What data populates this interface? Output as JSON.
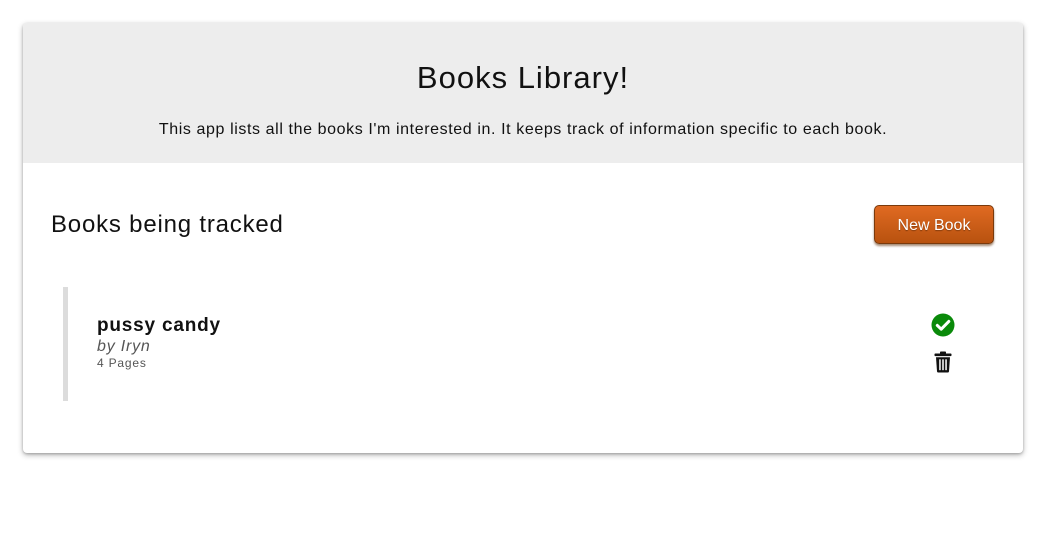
{
  "header": {
    "title": "Books Library!",
    "description": "This app lists all the books I'm interested in. It keeps track of information specific to each book."
  },
  "section": {
    "title": "Books being tracked",
    "new_book_label": "New Book"
  },
  "books": [
    {
      "title": "pussy candy",
      "author_prefix": "by",
      "author": "Iryn",
      "pages": "4",
      "pages_suffix": "Pages",
      "read": true
    }
  ],
  "icons": {
    "read_icon": "check-circle-icon",
    "delete_icon": "trash-icon"
  },
  "colors": {
    "accent": "#c85a16",
    "header_bg": "#ededed",
    "read_status": "#0a8a0a",
    "item_border": "#dcdcdc"
  }
}
